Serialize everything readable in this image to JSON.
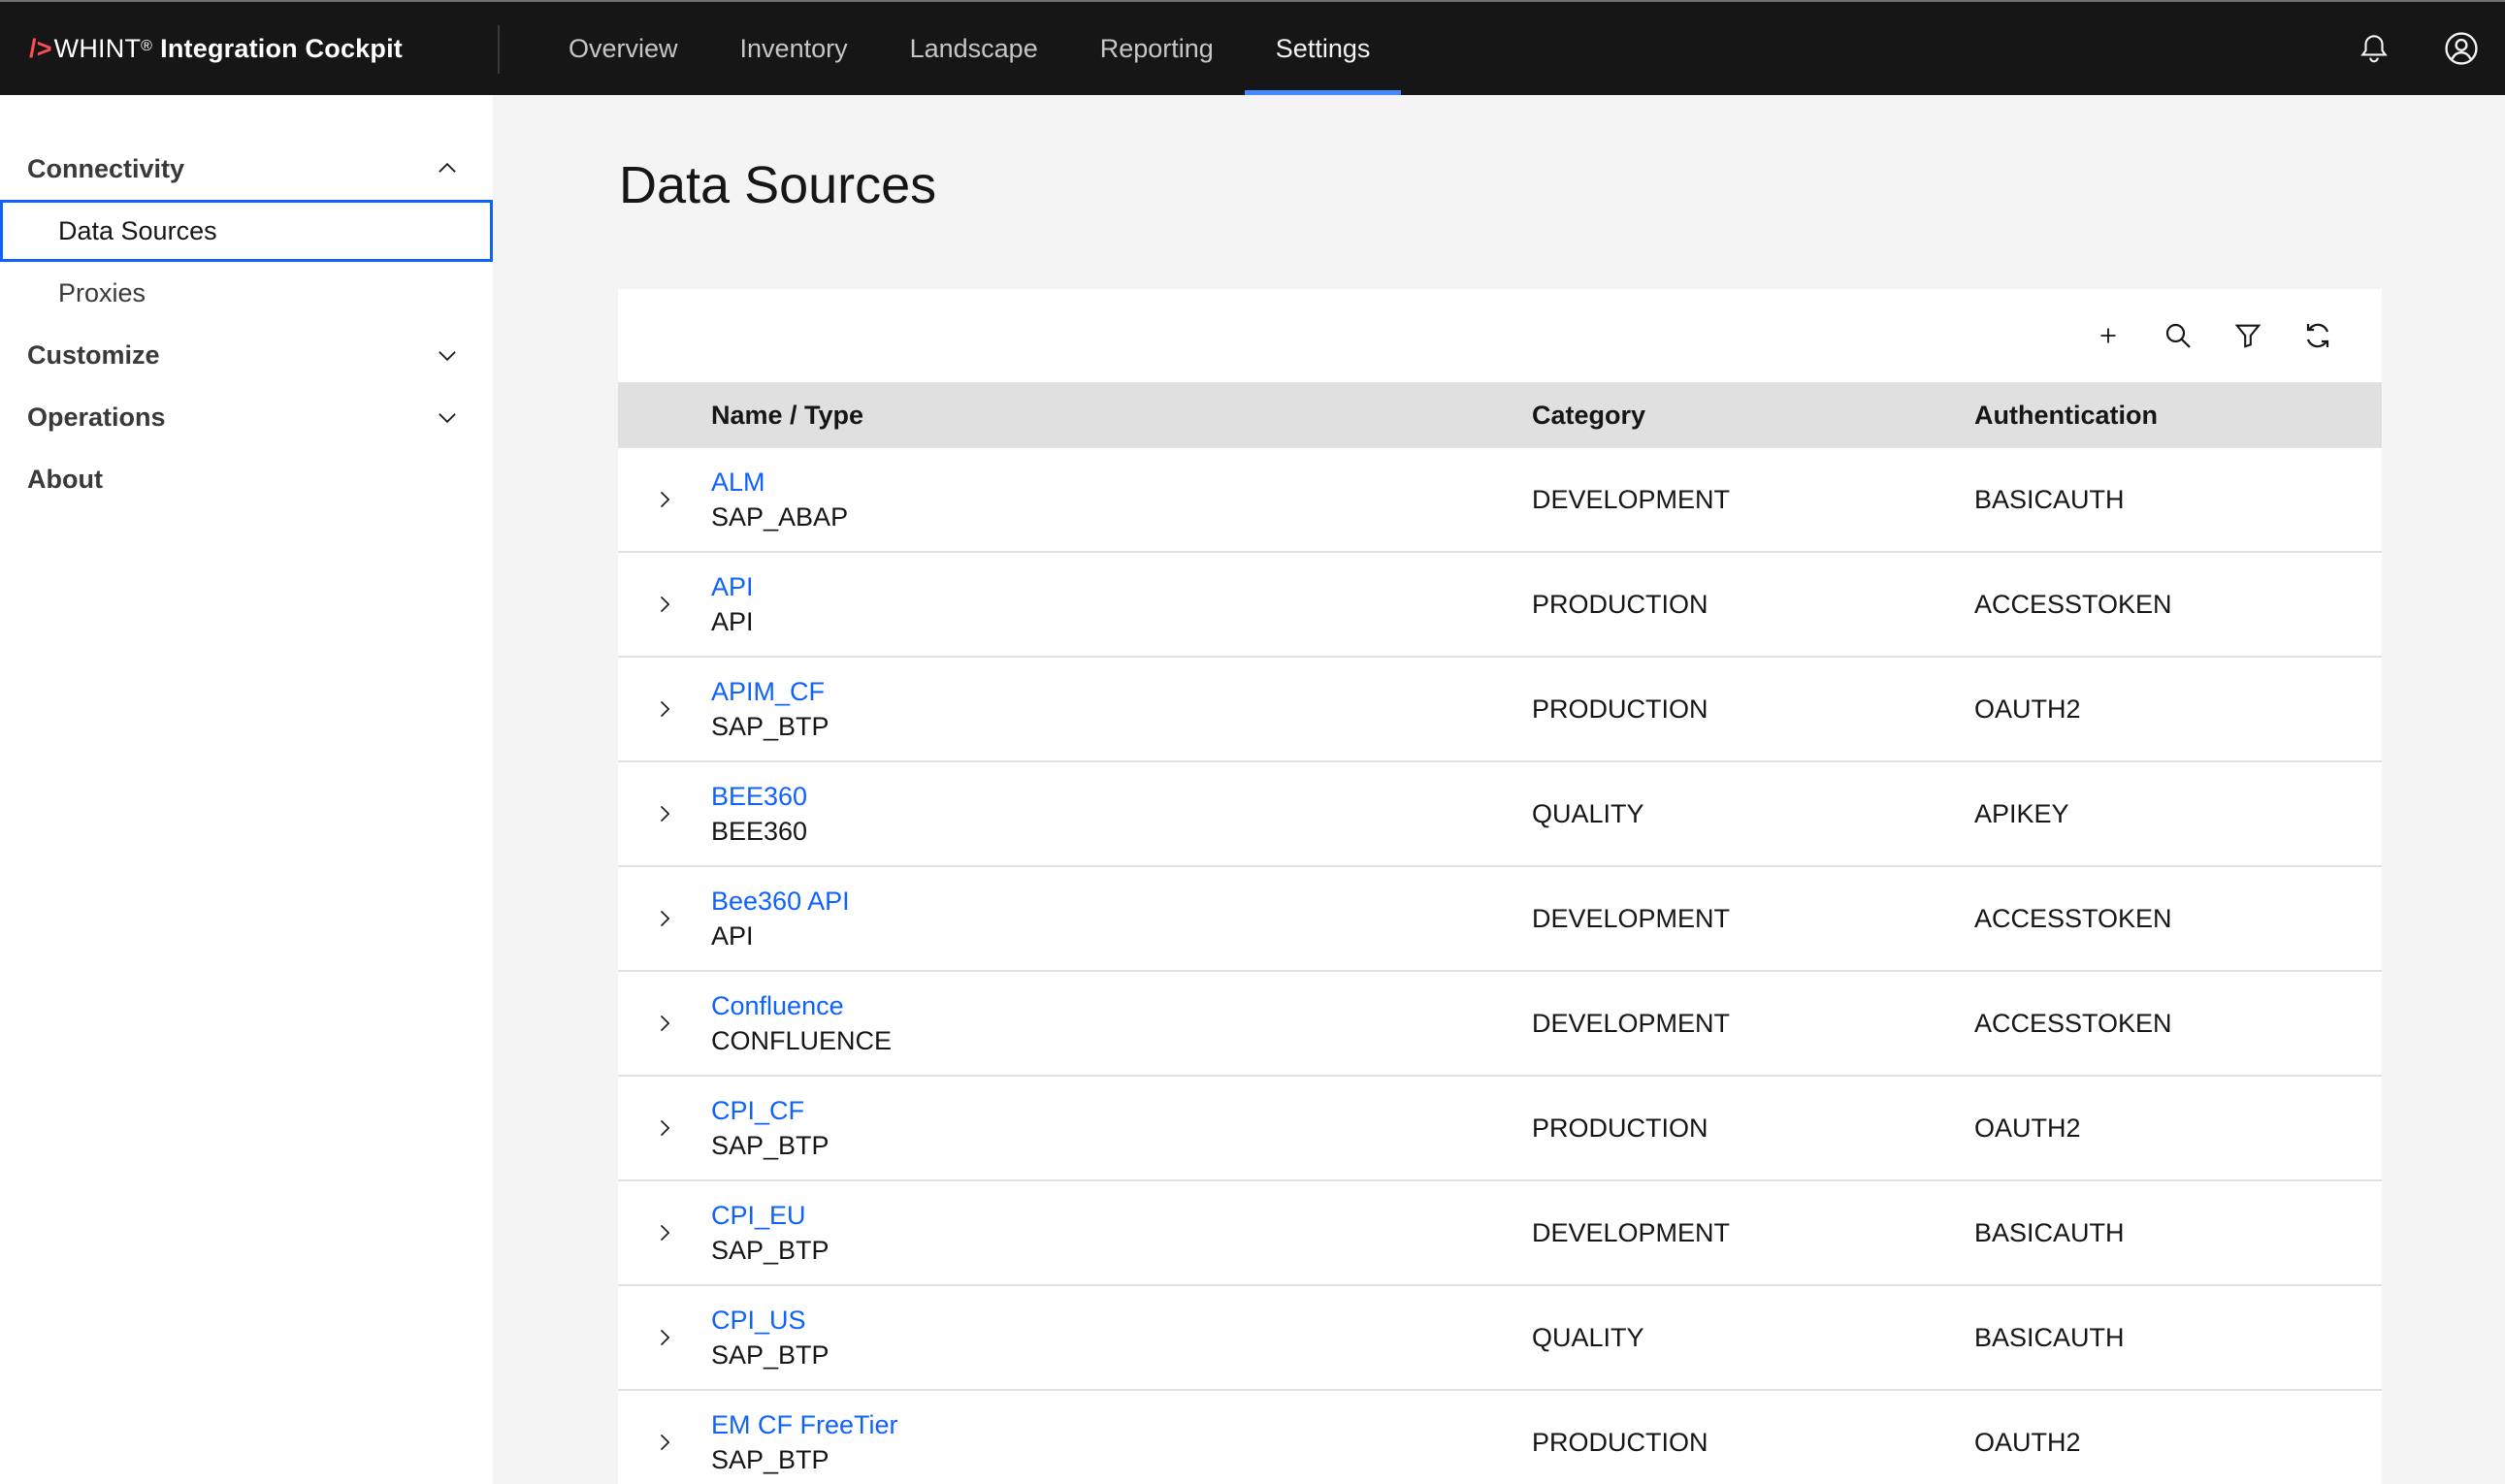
{
  "header": {
    "brand_prefix": "/>",
    "brand_name": "WHINT",
    "brand_reg": "®",
    "brand_product": "Integration Cockpit",
    "nav": [
      {
        "label": "Overview"
      },
      {
        "label": "Inventory"
      },
      {
        "label": "Landscape"
      },
      {
        "label": "Reporting"
      },
      {
        "label": "Settings",
        "active": true
      }
    ],
    "icons": [
      "notification-icon",
      "user-avatar-icon"
    ]
  },
  "sidebar": {
    "groups": [
      {
        "label": "Connectivity",
        "expanded": true,
        "items": [
          {
            "label": "Data Sources",
            "selected": true
          },
          {
            "label": "Proxies"
          }
        ]
      },
      {
        "label": "Customize",
        "expanded": false
      },
      {
        "label": "Operations",
        "expanded": false
      },
      {
        "label": "About"
      }
    ]
  },
  "main": {
    "title": "Data Sources",
    "toolbar_icons": [
      "add-icon",
      "search-icon",
      "filter-icon",
      "refresh-icon"
    ],
    "columns": {
      "name": "Name / Type",
      "category": "Category",
      "auth": "Authentication"
    },
    "rows": [
      {
        "name": "ALM",
        "type": "SAP_ABAP",
        "category": "DEVELOPMENT",
        "auth": "BASICAUTH"
      },
      {
        "name": "API",
        "type": "API",
        "category": "PRODUCTION",
        "auth": "ACCESSTOKEN"
      },
      {
        "name": "APIM_CF",
        "type": "SAP_BTP",
        "category": "PRODUCTION",
        "auth": "OAUTH2"
      },
      {
        "name": "BEE360",
        "type": "BEE360",
        "category": "QUALITY",
        "auth": "APIKEY"
      },
      {
        "name": "Bee360 API",
        "type": "API",
        "category": "DEVELOPMENT",
        "auth": "ACCESSTOKEN"
      },
      {
        "name": "Confluence",
        "type": "CONFLUENCE",
        "category": "DEVELOPMENT",
        "auth": "ACCESSTOKEN"
      },
      {
        "name": "CPI_CF",
        "type": "SAP_BTP",
        "category": "PRODUCTION",
        "auth": "OAUTH2"
      },
      {
        "name": "CPI_EU",
        "type": "SAP_BTP",
        "category": "DEVELOPMENT",
        "auth": "BASICAUTH"
      },
      {
        "name": "CPI_US",
        "type": "SAP_BTP",
        "category": "QUALITY",
        "auth": "BASICAUTH"
      },
      {
        "name": "EM CF FreeTier",
        "type": "SAP_BTP",
        "category": "PRODUCTION",
        "auth": "OAUTH2"
      }
    ]
  },
  "colors": {
    "header_bg": "#161616",
    "accent": "#0f62fe",
    "active_tab": "#4589ff",
    "brand_red": "#fa4d56"
  }
}
